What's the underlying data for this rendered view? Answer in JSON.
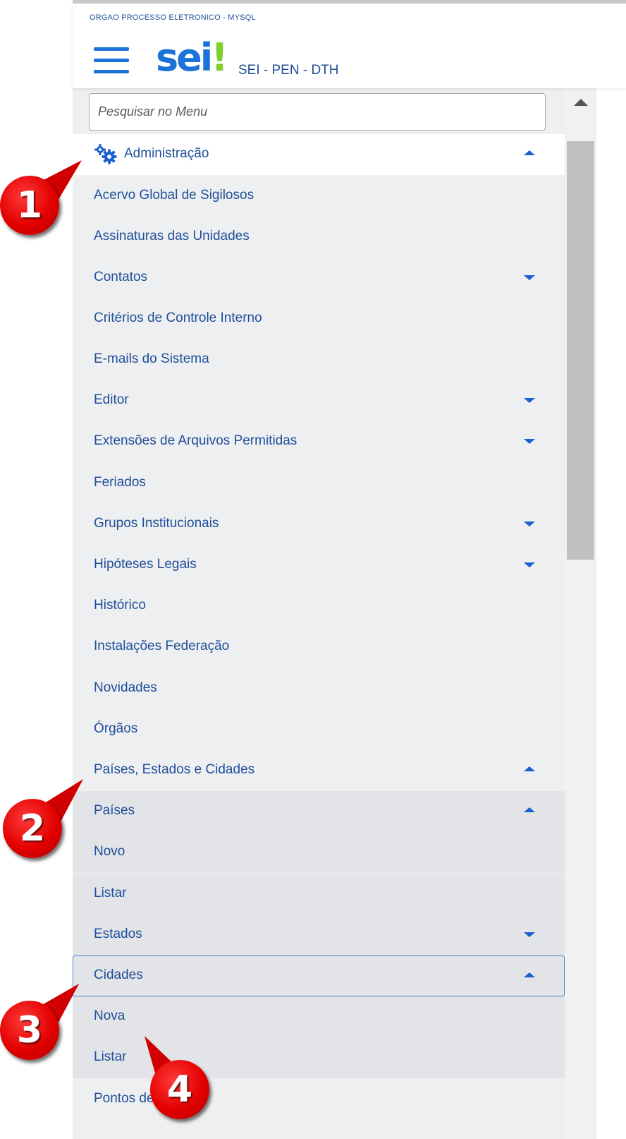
{
  "header": {
    "org": "ORGAO PROCESSO ELETRONICO - MYSQL",
    "logo": "sei!",
    "instance": "SEI - PEN - DTH"
  },
  "search": {
    "placeholder": "Pesquisar no Menu",
    "value": ""
  },
  "menu": {
    "section": {
      "label": "Administração",
      "icon": "gears-icon",
      "expanded": true
    },
    "items": [
      {
        "label": "Acervo Global de Sigilosos",
        "caret": "none"
      },
      {
        "label": "Assinaturas das Unidades",
        "caret": "none"
      },
      {
        "label": "Contatos",
        "caret": "down"
      },
      {
        "label": "Critérios de Controle Interno",
        "caret": "none"
      },
      {
        "label": "E-mails do Sistema",
        "caret": "none"
      },
      {
        "label": "Editor",
        "caret": "down"
      },
      {
        "label": "Extensões de Arquivos Permitidas",
        "caret": "down"
      },
      {
        "label": "Feriados",
        "caret": "none"
      },
      {
        "label": "Grupos Institucionais",
        "caret": "down"
      },
      {
        "label": "Hipóteses Legais",
        "caret": "down"
      },
      {
        "label": "Histórico",
        "caret": "none"
      },
      {
        "label": "Instalações Federação",
        "caret": "none"
      },
      {
        "label": "Novidades",
        "caret": "none"
      },
      {
        "label": "Órgãos",
        "caret": "none"
      },
      {
        "label": "Países, Estados e Cidades",
        "caret": "up"
      },
      {
        "label": "Países",
        "caret": "up"
      },
      {
        "label": "Novo",
        "caret": "none"
      },
      {
        "label": "Listar",
        "caret": "none"
      },
      {
        "label": "Estados",
        "caret": "down"
      },
      {
        "label": "Cidades",
        "caret": "up"
      },
      {
        "label": "Nova",
        "caret": "none"
      },
      {
        "label": "Listar",
        "caret": "none"
      },
      {
        "label": "Pontos de Controle",
        "caret": "none"
      }
    ]
  },
  "badges": [
    "1",
    "2",
    "3",
    "4"
  ],
  "colors": {
    "link": "#1f4f9a",
    "accent": "#1a73d9",
    "badge": "#e30000",
    "logo_bang": "#7fcf2f"
  }
}
